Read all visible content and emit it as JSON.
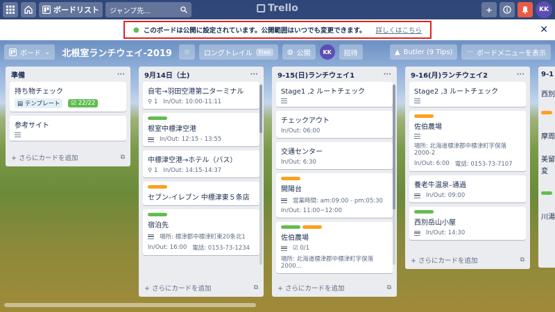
{
  "topbar": {
    "board_list": "ボードリスト",
    "search": "ジャンプ先...",
    "logo": "Trello",
    "avatar": "KK"
  },
  "banner": {
    "message": "このボードは公開に設定されています。公開範囲はいつでも変更できます。",
    "link": "詳しくはこちら"
  },
  "boardbar": {
    "board_menu": "ボード",
    "title": "北根室ランチウェイ-2019",
    "team": "ロングトレイル",
    "team_badge": "Free",
    "visibility": "公開",
    "avatar": "KK",
    "invite": "招待",
    "butler": "Butler (9 Tips)",
    "show_menu": "ボードメニューを表示"
  },
  "add_card": "さらにカードを追加",
  "lists": [
    {
      "title": "準備",
      "cards": [
        {
          "title": "持ち物チェック",
          "template": "テンプレート",
          "checklist": "22/22"
        },
        {
          "title": "参考サイト"
        }
      ]
    },
    {
      "title": "9月14日（土)",
      "cards": [
        {
          "title": "自宅→羽田空港第二ターミナル",
          "attach": "1",
          "inout": "In/Out: 10:00-11:11"
        },
        {
          "title": "根室中標津空港",
          "inout": "In/Out: 12:15 - 13:55"
        },
        {
          "title": "中標津空港→ホテル（バス）",
          "attach": "1",
          "inout": "In/Out: 14:15-14:37"
        },
        {
          "title": "セブン-イレブン 中標津東５条店"
        },
        {
          "title": "宿泊先",
          "place": "場所: 標津郡中標津町東20条北1",
          "inout": "In/Out: 16:00",
          "tel": "電話: 0153-73-1234"
        }
      ]
    },
    {
      "title": "9-15(日)ランチウェイ1",
      "cards": [
        {
          "title": "Stage1 ,2 ルートチェック"
        },
        {
          "title": "チェックアウト",
          "inout": "In/Out: 06:00"
        },
        {
          "title": "交通センター",
          "inout": "In/Out: 6:30"
        },
        {
          "title": "開陽台",
          "hours": "営業時間: am:09:00 - pm:05:30",
          "inout": "In/Out: 11:00~12:00"
        },
        {
          "title": "佐伯農場",
          "check": "0/1",
          "place": "場所: 北海道標津郡中標津町字俣落2000..."
        }
      ]
    },
    {
      "title": "9-16(月)ランチウェイ2",
      "cards": [
        {
          "title": "Stage2 ,3 ルートチェック"
        },
        {
          "title": "佐伯農場",
          "place": "場所: 北海道標津郡中標津町字俣落2000-2",
          "inout": "In/Out: 6:00",
          "tel": "電話: 0153-73-7107"
        },
        {
          "title": "養老牛温泉–通過",
          "inout": "In/Out: 09:00"
        },
        {
          "title": "西別岳山小屋",
          "inout": "In/Out: 14:30"
        }
      ]
    },
    {
      "title": "9-1",
      "cards": [
        {
          "title": "西別"
        },
        {
          "title": "摩周"
        },
        {
          "title": "美留"
        },
        {
          "title": "変"
        },
        {
          "title": "川湯"
        }
      ]
    }
  ],
  "colors": {
    "green": "#61bd4f",
    "orange": "#ff9f1a",
    "blue": "#0079bf",
    "purple": "#5e4db2",
    "red": "#eb5a46"
  }
}
